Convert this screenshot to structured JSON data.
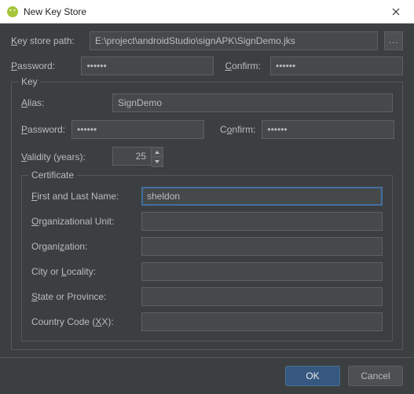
{
  "window": {
    "title": "New Key Store"
  },
  "keystore": {
    "path_label": "Key store path:",
    "path_value": "E:\\project\\androidStudio\\signAPK\\SignDemo.jks",
    "browse_label": "...",
    "password_label": "Password:",
    "password_value": "••••••",
    "confirm_label": "Confirm:",
    "confirm_value": "••••••"
  },
  "key": {
    "legend": "Key",
    "alias_label": "Alias:",
    "alias_value": "SignDemo",
    "password_label": "Password:",
    "password_value": "••••••",
    "confirm_label": "Confirm:",
    "confirm_value": "••••••",
    "validity_label": "Validity (years):",
    "validity_value": "25"
  },
  "certificate": {
    "legend": "Certificate",
    "first_last_label": "First and Last Name:",
    "first_last_value": "sheldon",
    "org_unit_label": "Organizational Unit:",
    "org_unit_value": "",
    "organization_label": "Organization:",
    "organization_value": "",
    "city_label": "City or Locality:",
    "city_value": "",
    "state_label": "State or Province:",
    "state_value": "",
    "country_label": "Country Code (XX):",
    "country_value": ""
  },
  "footer": {
    "ok_label": "OK",
    "cancel_label": "Cancel"
  }
}
